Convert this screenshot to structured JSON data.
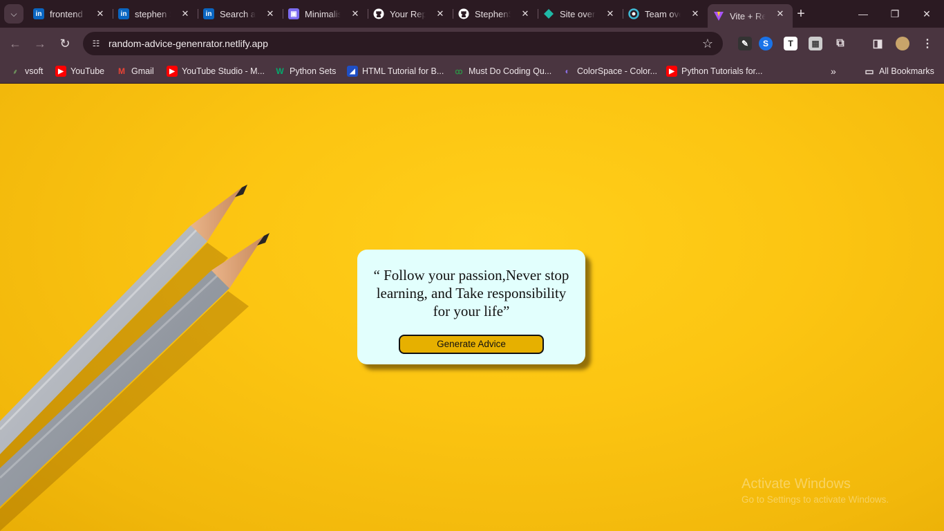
{
  "browser": {
    "tabs": [
      {
        "title": "frontend developer",
        "favicon": "linkedin-icon",
        "color": "#0a66c2"
      },
      {
        "title": "stephen Stephen",
        "favicon": "linkedin-icon",
        "color": "#0a66c2"
      },
      {
        "title": "Search all",
        "favicon": "linkedin-icon",
        "color": "#0a66c2"
      },
      {
        "title": "Minimalist",
        "favicon": "app-icon",
        "color": "#7c6cf0"
      },
      {
        "title": "Your Repositories",
        "favicon": "github-icon",
        "color": "#ffffff"
      },
      {
        "title": "StephenSt",
        "favicon": "github-icon",
        "color": "#ffffff"
      },
      {
        "title": "Site overview",
        "favicon": "netlify-icon",
        "color": "#1fb8a6"
      },
      {
        "title": "Team overview",
        "favicon": "netlify-team-icon",
        "color": "#3fb9d4"
      },
      {
        "title": "Vite + React",
        "favicon": "vite-icon",
        "color": "#a855f7",
        "active": true
      }
    ],
    "url": "random-advice-genenrator.netlify.app",
    "bookmarks": [
      {
        "label": "vsoft",
        "icon": "vsoft-icon"
      },
      {
        "label": "YouTube",
        "icon": "youtube-icon"
      },
      {
        "label": "Gmail",
        "icon": "gmail-icon"
      },
      {
        "label": "YouTube Studio - M...",
        "icon": "youtube-studio-icon"
      },
      {
        "label": "Python Sets",
        "icon": "w3schools-icon"
      },
      {
        "label": "HTML Tutorial for B...",
        "icon": "html-tutorial-icon"
      },
      {
        "label": "Must Do Coding Qu...",
        "icon": "geeksforgeeks-icon"
      },
      {
        "label": "ColorSpace - Color...",
        "icon": "colorspace-icon"
      },
      {
        "label": "Python Tutorials for...",
        "icon": "youtube-icon"
      }
    ],
    "all_bookmarks_label": "All Bookmarks"
  },
  "page": {
    "advice": "“ Follow your passion,Never stop learning, and Take responsibility for your life”",
    "button_label": "Generate Advice"
  },
  "watermark": {
    "line1": "Activate Windows",
    "line2": "Go to Settings to activate Windows."
  }
}
